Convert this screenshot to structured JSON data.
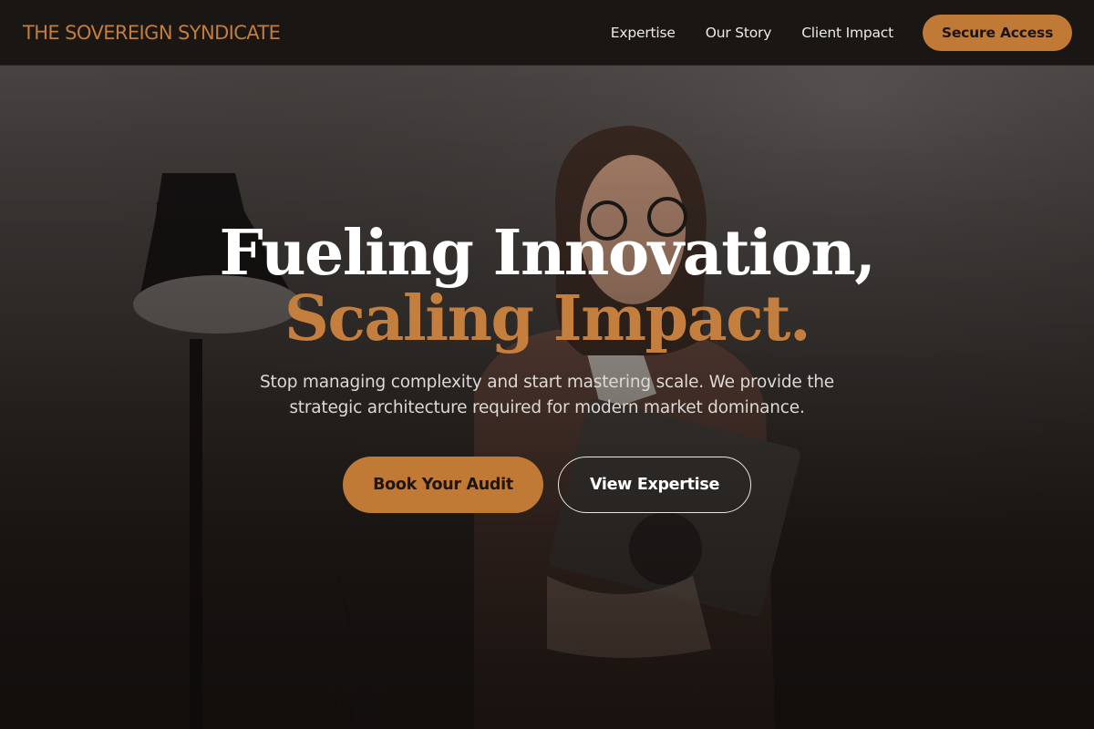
{
  "header": {
    "brand": "THE SOVEREIGN SYNDICATE",
    "nav": [
      "Expertise",
      "Our Story",
      "Client Impact"
    ],
    "cta": "Secure Access"
  },
  "hero": {
    "headline_line1": "Fueling Innovation,",
    "headline_line2": "Scaling Impact.",
    "subtext": "Stop managing complexity and start mastering scale. We provide the strategic architecture required for modern market dominance.",
    "primary_button": "Book Your Audit",
    "secondary_button": "View Expertise"
  },
  "colors": {
    "accent": "#c17d3d",
    "header_bg": "#1a1613",
    "text_light": "#ffffff"
  }
}
